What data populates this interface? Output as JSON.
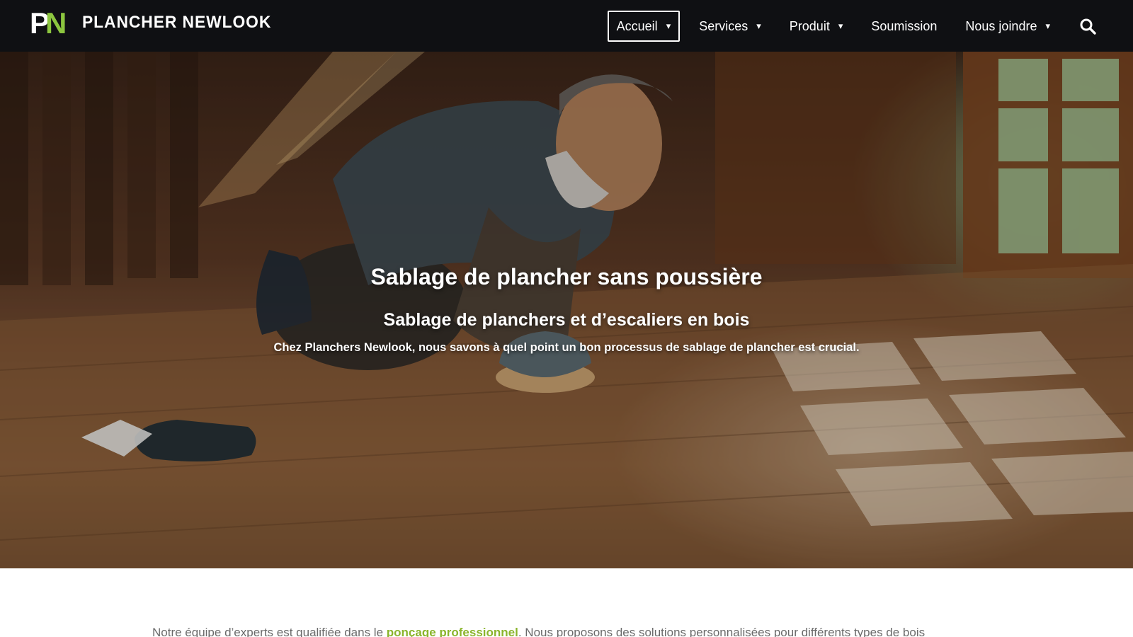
{
  "header": {
    "logo": {
      "text": "PN",
      "icon": "pn-logo-icon",
      "letter_colors": [
        "#ffffff",
        "#8cc63f"
      ]
    },
    "brand_name": "PLANCHER NEWLOOK",
    "nav": [
      {
        "label": "Accueil",
        "dropdown": true,
        "active": true
      },
      {
        "label": "Services",
        "dropdown": true,
        "active": false
      },
      {
        "label": "Produit",
        "dropdown": true,
        "active": false
      },
      {
        "label": "Soumission",
        "dropdown": false,
        "active": false
      },
      {
        "label": "Nous joindre",
        "dropdown": true,
        "active": false
      }
    ],
    "caret": "▾",
    "search_icon": "search-icon"
  },
  "hero": {
    "title": "Sablage de plancher sans poussière",
    "subtitle": "Sablage de planchers et d’escaliers en bois",
    "tagline": "Chez Planchers Newlook, nous savons à quel point un bon processus de sablage de plancher est crucial."
  },
  "intro": {
    "before_link": "Notre équipe d’experts est qualifiée dans le ",
    "link_text": "ponçage professionnel",
    "after_link": ". Nous proposons des solutions personnalisées pour différents types de bois"
  },
  "colors": {
    "header_bg": "#0f1013",
    "accent_green": "#8cc63f",
    "link_green": "#8ab52c",
    "body_text": "#6a6a6a"
  }
}
